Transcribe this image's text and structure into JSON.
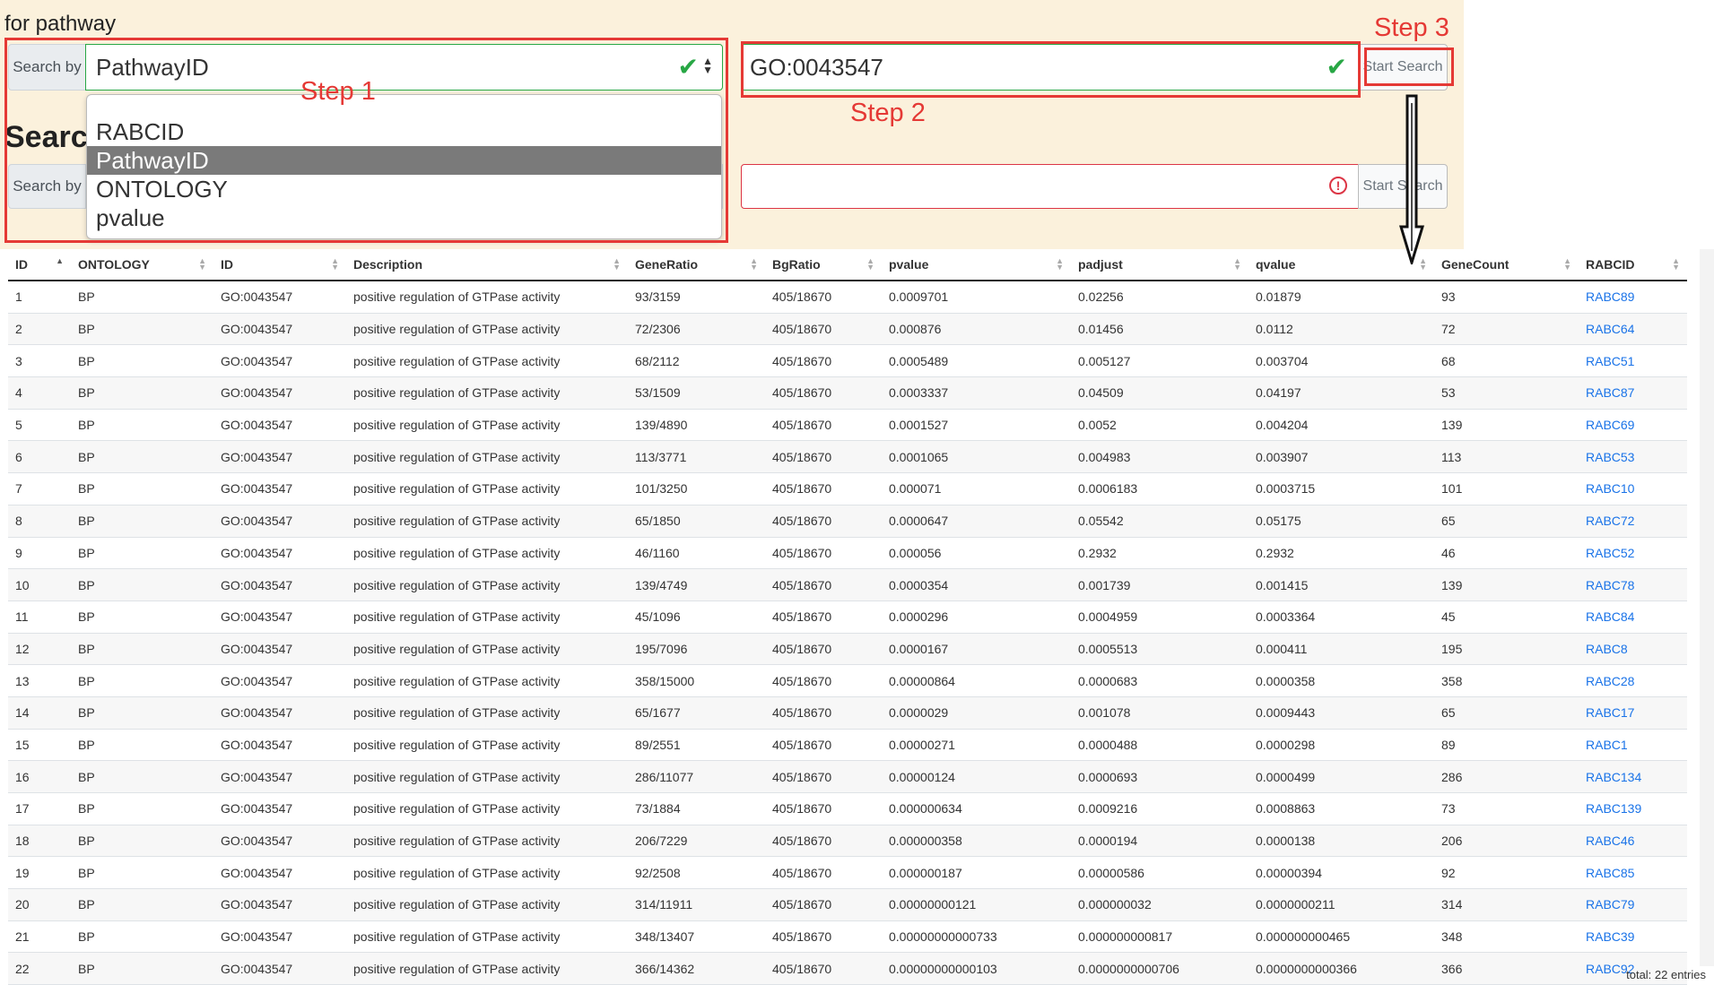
{
  "header": {
    "pathway_heading": "for pathway",
    "second_heading": "Searc"
  },
  "search1": {
    "label": "Search by",
    "selected": "PathwayID",
    "options": [
      "RABCID",
      "PathwayID",
      "ONTOLOGY",
      "pvalue"
    ],
    "value": "GO:0043547",
    "button": "Start Search"
  },
  "search2": {
    "label": "Search by",
    "value": "",
    "button": "Start Search"
  },
  "steps": {
    "step1": "Step 1",
    "step2": "Step 2",
    "step3": "Step 3"
  },
  "table": {
    "columns": [
      "ID",
      "ONTOLOGY",
      "ID",
      "Description",
      "GeneRatio",
      "BgRatio",
      "pvalue",
      "padjust",
      "qvalue",
      "GeneCount",
      "RABCID"
    ],
    "rows": [
      [
        "1",
        "BP",
        "GO:0043547",
        "positive regulation of GTPase activity",
        "93/3159",
        "405/18670",
        "0.0009701",
        "0.02256",
        "0.01879",
        "93",
        "RABC89"
      ],
      [
        "2",
        "BP",
        "GO:0043547",
        "positive regulation of GTPase activity",
        "72/2306",
        "405/18670",
        "0.000876",
        "0.01456",
        "0.0112",
        "72",
        "RABC64"
      ],
      [
        "3",
        "BP",
        "GO:0043547",
        "positive regulation of GTPase activity",
        "68/2112",
        "405/18670",
        "0.0005489",
        "0.005127",
        "0.003704",
        "68",
        "RABC51"
      ],
      [
        "4",
        "BP",
        "GO:0043547",
        "positive regulation of GTPase activity",
        "53/1509",
        "405/18670",
        "0.0003337",
        "0.04509",
        "0.04197",
        "53",
        "RABC87"
      ],
      [
        "5",
        "BP",
        "GO:0043547",
        "positive regulation of GTPase activity",
        "139/4890",
        "405/18670",
        "0.0001527",
        "0.0052",
        "0.004204",
        "139",
        "RABC69"
      ],
      [
        "6",
        "BP",
        "GO:0043547",
        "positive regulation of GTPase activity",
        "113/3771",
        "405/18670",
        "0.0001065",
        "0.004983",
        "0.003907",
        "113",
        "RABC53"
      ],
      [
        "7",
        "BP",
        "GO:0043547",
        "positive regulation of GTPase activity",
        "101/3250",
        "405/18670",
        "0.000071",
        "0.0006183",
        "0.0003715",
        "101",
        "RABC10"
      ],
      [
        "8",
        "BP",
        "GO:0043547",
        "positive regulation of GTPase activity",
        "65/1850",
        "405/18670",
        "0.0000647",
        "0.05542",
        "0.05175",
        "65",
        "RABC72"
      ],
      [
        "9",
        "BP",
        "GO:0043547",
        "positive regulation of GTPase activity",
        "46/1160",
        "405/18670",
        "0.000056",
        "0.2932",
        "0.2932",
        "46",
        "RABC52"
      ],
      [
        "10",
        "BP",
        "GO:0043547",
        "positive regulation of GTPase activity",
        "139/4749",
        "405/18670",
        "0.0000354",
        "0.001739",
        "0.001415",
        "139",
        "RABC78"
      ],
      [
        "11",
        "BP",
        "GO:0043547",
        "positive regulation of GTPase activity",
        "45/1096",
        "405/18670",
        "0.0000296",
        "0.0004959",
        "0.0003364",
        "45",
        "RABC84"
      ],
      [
        "12",
        "BP",
        "GO:0043547",
        "positive regulation of GTPase activity",
        "195/7096",
        "405/18670",
        "0.0000167",
        "0.0005513",
        "0.000411",
        "195",
        "RABC8"
      ],
      [
        "13",
        "BP",
        "GO:0043547",
        "positive regulation of GTPase activity",
        "358/15000",
        "405/18670",
        "0.00000864",
        "0.0000683",
        "0.0000358",
        "358",
        "RABC28"
      ],
      [
        "14",
        "BP",
        "GO:0043547",
        "positive regulation of GTPase activity",
        "65/1677",
        "405/18670",
        "0.0000029",
        "0.001078",
        "0.0009443",
        "65",
        "RABC17"
      ],
      [
        "15",
        "BP",
        "GO:0043547",
        "positive regulation of GTPase activity",
        "89/2551",
        "405/18670",
        "0.00000271",
        "0.0000488",
        "0.0000298",
        "89",
        "RABC1"
      ],
      [
        "16",
        "BP",
        "GO:0043547",
        "positive regulation of GTPase activity",
        "286/11077",
        "405/18670",
        "0.00000124",
        "0.0000693",
        "0.0000499",
        "286",
        "RABC134"
      ],
      [
        "17",
        "BP",
        "GO:0043547",
        "positive regulation of GTPase activity",
        "73/1884",
        "405/18670",
        "0.000000634",
        "0.0009216",
        "0.0008863",
        "73",
        "RABC139"
      ],
      [
        "18",
        "BP",
        "GO:0043547",
        "positive regulation of GTPase activity",
        "206/7229",
        "405/18670",
        "0.000000358",
        "0.0000194",
        "0.0000138",
        "206",
        "RABC46"
      ],
      [
        "19",
        "BP",
        "GO:0043547",
        "positive regulation of GTPase activity",
        "92/2508",
        "405/18670",
        "0.000000187",
        "0.00000586",
        "0.00000394",
        "92",
        "RABC85"
      ],
      [
        "20",
        "BP",
        "GO:0043547",
        "positive regulation of GTPase activity",
        "314/11911",
        "405/18670",
        "0.00000000121",
        "0.000000032",
        "0.0000000211",
        "314",
        "RABC79"
      ],
      [
        "21",
        "BP",
        "GO:0043547",
        "positive regulation of GTPase activity",
        "348/13407",
        "405/18670",
        "0.00000000000733",
        "0.000000000817",
        "0.000000000465",
        "348",
        "RABC39"
      ],
      [
        "22",
        "BP",
        "GO:0043547",
        "positive regulation of GTPase activity",
        "366/14362",
        "405/18670",
        "0.00000000000103",
        "0.0000000000706",
        "0.0000000000366",
        "366",
        "RABC92"
      ]
    ]
  },
  "footer": {
    "total": "total:  22 entries"
  },
  "colors": {
    "panel_bg": "#fbf1dc",
    "step_red": "#e53935",
    "valid_green": "#28a745",
    "invalid_red": "#dc3545",
    "link_blue": "#1a73e8"
  }
}
